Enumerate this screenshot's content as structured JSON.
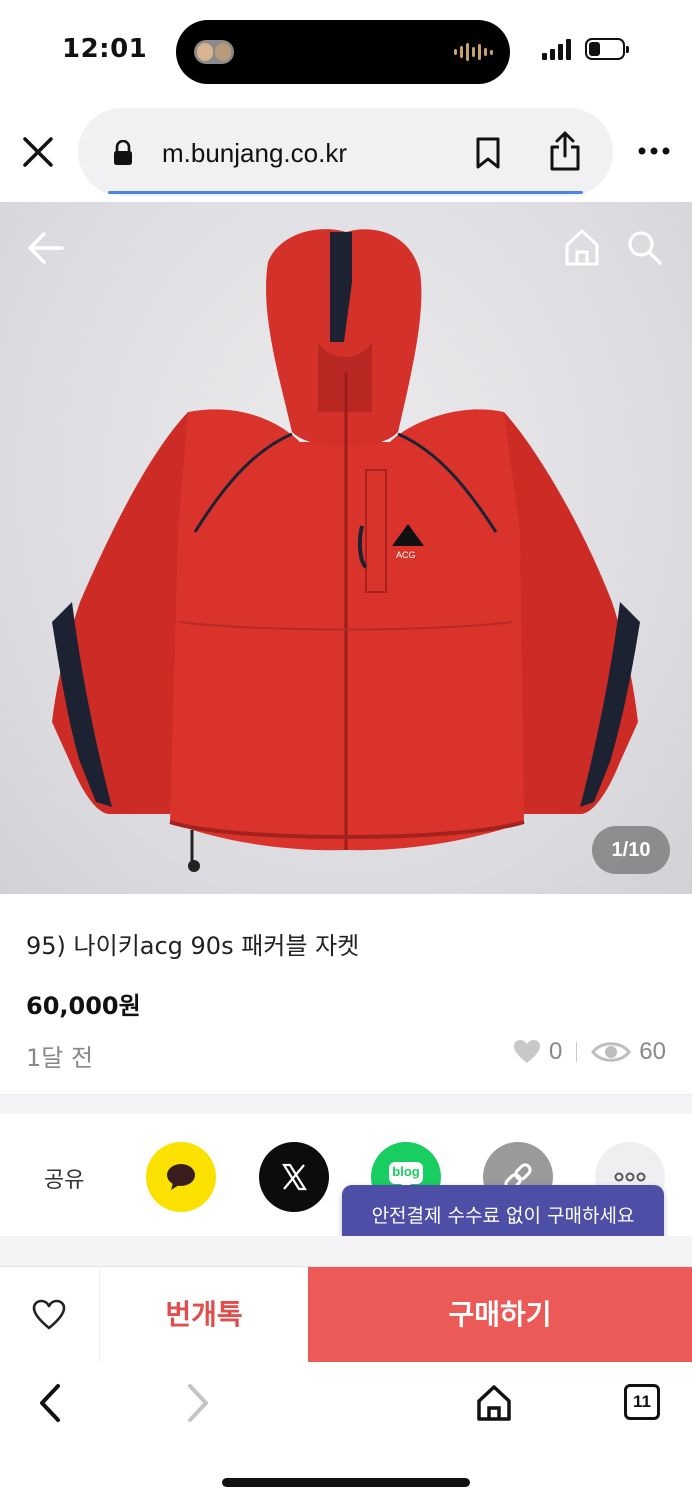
{
  "status_bar": {
    "time": "12:01"
  },
  "browser": {
    "url": "m.bunjang.co.kr",
    "tab_count": "11"
  },
  "photo": {
    "counter": "1/10"
  },
  "product": {
    "title": "95) 나이키acg 90s 패커블 자켓",
    "price": "60,000원",
    "time_ago": "1달 전",
    "likes": "0",
    "views": "60"
  },
  "share": {
    "label": "공유",
    "items": [
      {
        "icon": "kakaotalk-icon",
        "color": "#fae100"
      },
      {
        "icon": "x-icon",
        "color": "#0c0c0c"
      },
      {
        "icon": "blog-icon",
        "text": "blog",
        "color": "#19ce60"
      },
      {
        "icon": "link-icon",
        "color": "#9a9a9a"
      },
      {
        "icon": "more-icon",
        "color": "#efeff1"
      }
    ],
    "tooltip": "안전결제 수수료 없이 구매하세요"
  },
  "actions": {
    "chat_label": "번개톡",
    "buy_label": "구매하기",
    "accent": "#eb5a56",
    "tooltip_color": "#4d4fa7"
  }
}
